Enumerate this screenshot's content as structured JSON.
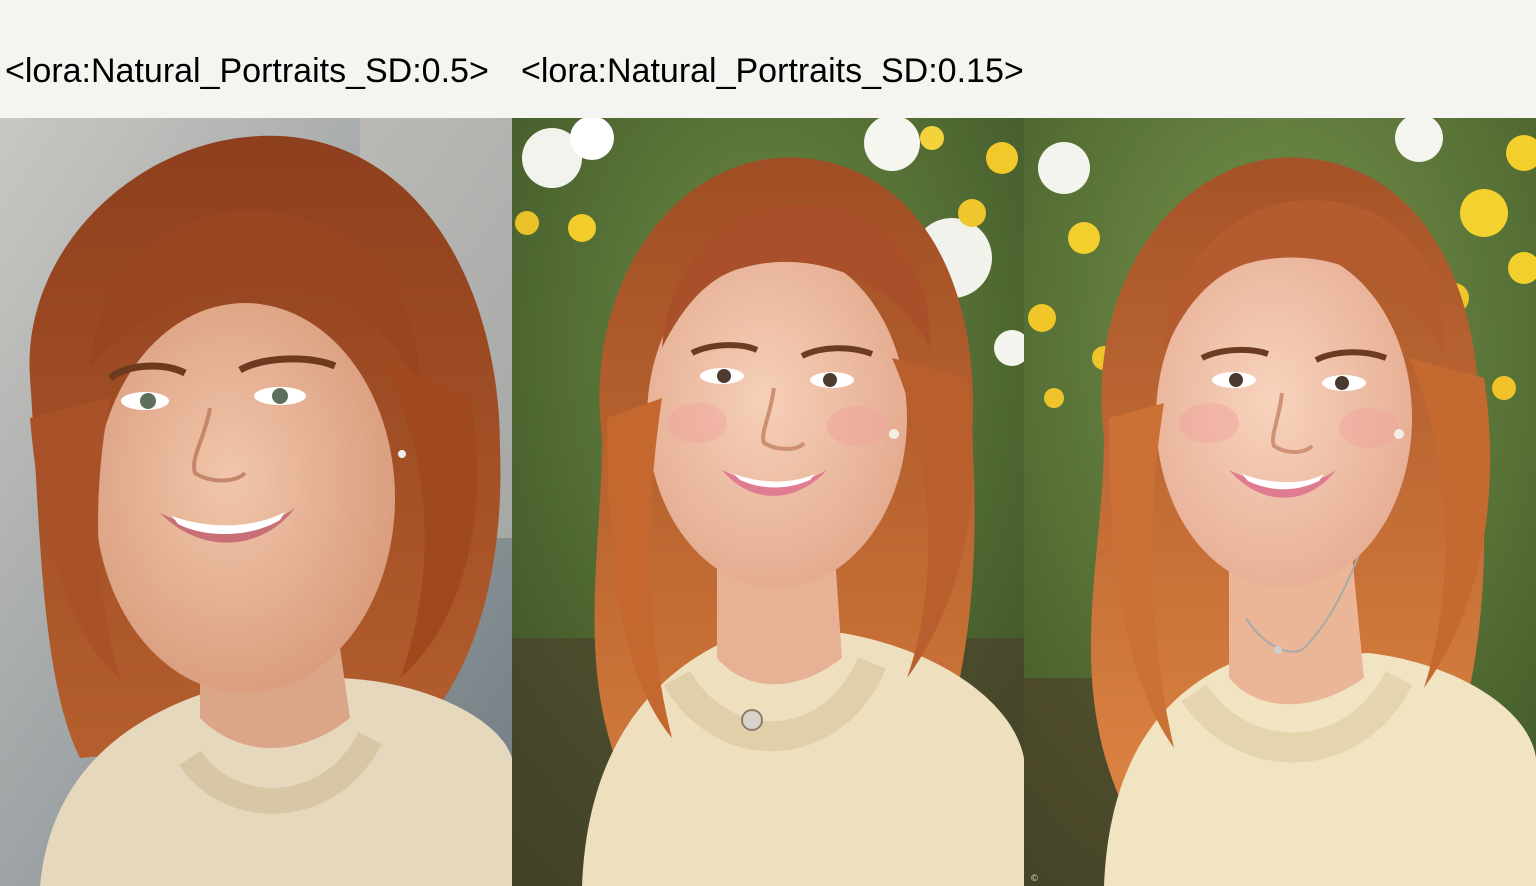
{
  "captions": [
    "<lora:Natural_Portraits_SD:0.5>",
    "<lora:Natural_Portraits_SD:0.15>"
  ],
  "images": [
    {
      "subject": "portrait-photo",
      "background": "grey-wall",
      "colors": {
        "bg": "#9aa0a2",
        "hair": "#a8532a",
        "skin": "#e8b89c",
        "sweater": "#e6d8bd"
      }
    },
    {
      "subject": "portrait-photo",
      "background": "flower-garden",
      "colors": {
        "bg": "#4f6a34",
        "hair": "#b8602f",
        "skin": "#efc3a8",
        "sweater": "#eee0bf"
      }
    },
    {
      "subject": "portrait-photo",
      "background": "flower-garden",
      "colors": {
        "bg": "#56733a",
        "hair": "#c06a36",
        "skin": "#f2c7ad",
        "sweater": "#f0e4c2"
      }
    }
  ]
}
